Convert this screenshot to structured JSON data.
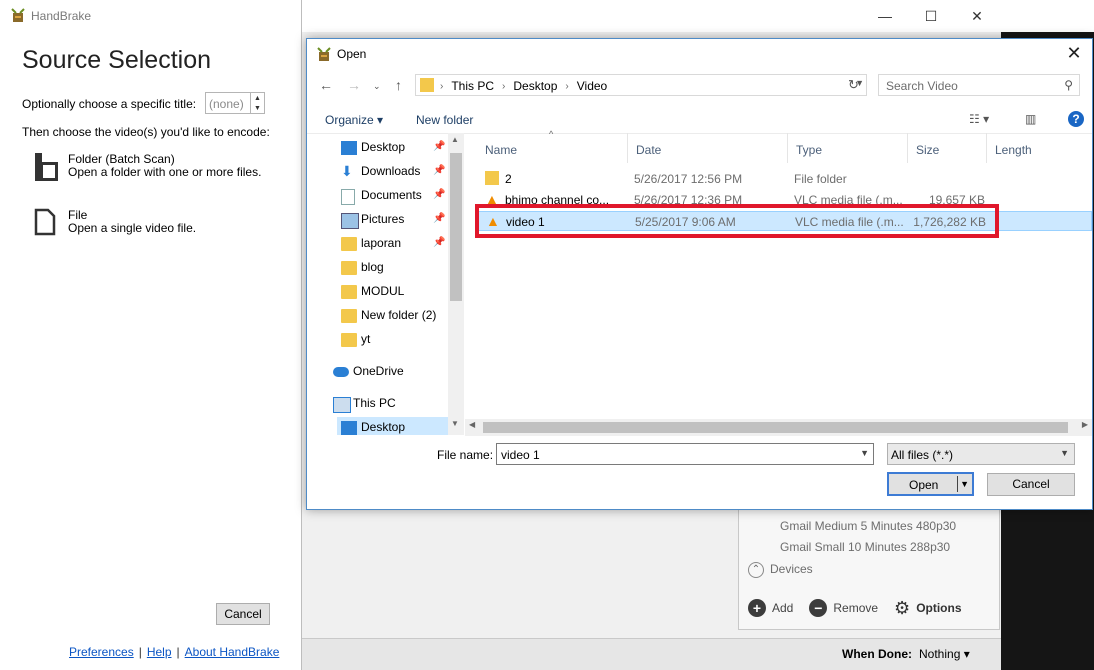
{
  "handbrake": {
    "window_title": "HandBrake",
    "heading": "Source Selection",
    "title_label": "Optionally choose a specific title:",
    "title_value": "(none)",
    "choose_label": "Then choose the video(s) you'd like to encode:",
    "folder_option": {
      "title": "Folder (Batch Scan)",
      "desc": "Open a folder with one or more files."
    },
    "file_option": {
      "title": "File",
      "desc": "Open a single video file."
    },
    "cancel_label": "Cancel",
    "links": [
      "Preferences",
      "Help",
      "About HandBrake"
    ],
    "separator": "|"
  },
  "background": {
    "presets": [
      "Gmail Medium 5 Minutes 480p30",
      "Gmail Small 10 Minutes 288p30"
    ],
    "devices_label": "Devices",
    "add_label": "Add",
    "remove_label": "Remove",
    "options_label": "Options",
    "when_done_label": "When Done:",
    "when_done_value": "Nothing ▾",
    "caption": {
      "minimize": "—",
      "maximize": "☐",
      "close": "✕"
    }
  },
  "dialog": {
    "title": "Open",
    "close": "✕",
    "breadcrumbs": [
      "This PC",
      "Desktop",
      "Video"
    ],
    "search_placeholder": "Search Video",
    "organize_label": "Organize ▾",
    "new_folder_label": "New folder",
    "help_label": "?",
    "nav_items": [
      {
        "label": "Desktop",
        "icon": "desktop-icon",
        "pinned": true
      },
      {
        "label": "Downloads",
        "icon": "download-icon",
        "pinned": true
      },
      {
        "label": "Documents",
        "icon": "documents-icon",
        "pinned": true
      },
      {
        "label": "Pictures",
        "icon": "pictures-icon",
        "pinned": true
      },
      {
        "label": "laporan",
        "icon": "folder-icon",
        "pinned": true
      },
      {
        "label": "blog",
        "icon": "folder-icon",
        "pinned": false
      },
      {
        "label": "MODUL",
        "icon": "folder-icon",
        "pinned": false
      },
      {
        "label": "New folder (2)",
        "icon": "folder-icon",
        "pinned": false
      },
      {
        "label": "yt",
        "icon": "folder-icon",
        "pinned": false
      },
      {
        "label": "OneDrive",
        "icon": "onedrive-icon",
        "pinned": false
      },
      {
        "label": "This PC",
        "icon": "pc-icon",
        "pinned": false
      },
      {
        "label": "Desktop",
        "icon": "desktop-icon",
        "pinned": false
      }
    ],
    "columns": [
      "Name",
      "Date",
      "Type",
      "Size",
      "Length"
    ],
    "files": [
      {
        "name": "2",
        "date": "5/26/2017 12:56 PM",
        "type": "File folder",
        "size": "",
        "icon": "folder-icon"
      },
      {
        "name": "bhimo channel co...",
        "date": "5/26/2017 12:36 PM",
        "type": "VLC media file (.m...",
        "size": "19,657 KB",
        "icon": "vlc-icon"
      },
      {
        "name": "video 1",
        "date": "5/25/2017 9:06 AM",
        "type": "VLC media file (.m...",
        "size": "1,726,282 KB",
        "icon": "vlc-icon"
      }
    ],
    "file_name_label": "File name:",
    "file_name_value": "video 1",
    "filter_value": "All files (*.*)",
    "open_label": "Open",
    "cancel_label": "Cancel"
  }
}
